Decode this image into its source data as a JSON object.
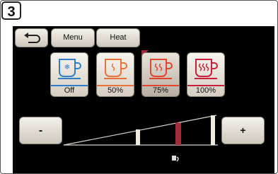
{
  "step_badge": "3",
  "header": {
    "back_icon": "back-arrow-icon",
    "menu_label": "Menu",
    "heat_label": "Heat"
  },
  "heat_levels": [
    {
      "label": "Off",
      "icon": "snowflake-cup-icon",
      "color": "#2e7fc8",
      "selected": false
    },
    {
      "label": "50%",
      "icon": "heat-cup-icon",
      "color": "#e8733a",
      "selected": false
    },
    {
      "label": "75%",
      "icon": "heat-cup-icon",
      "color": "#e0462f",
      "selected": true
    },
    {
      "label": "100%",
      "icon": "heat-cup-icon",
      "color": "#c8203a",
      "selected": false
    }
  ],
  "slider": {
    "minus_label": "-",
    "plus_label": "+",
    "level": 0.75,
    "accent": "#a12b38",
    "icon": "cup-hand-icon"
  }
}
